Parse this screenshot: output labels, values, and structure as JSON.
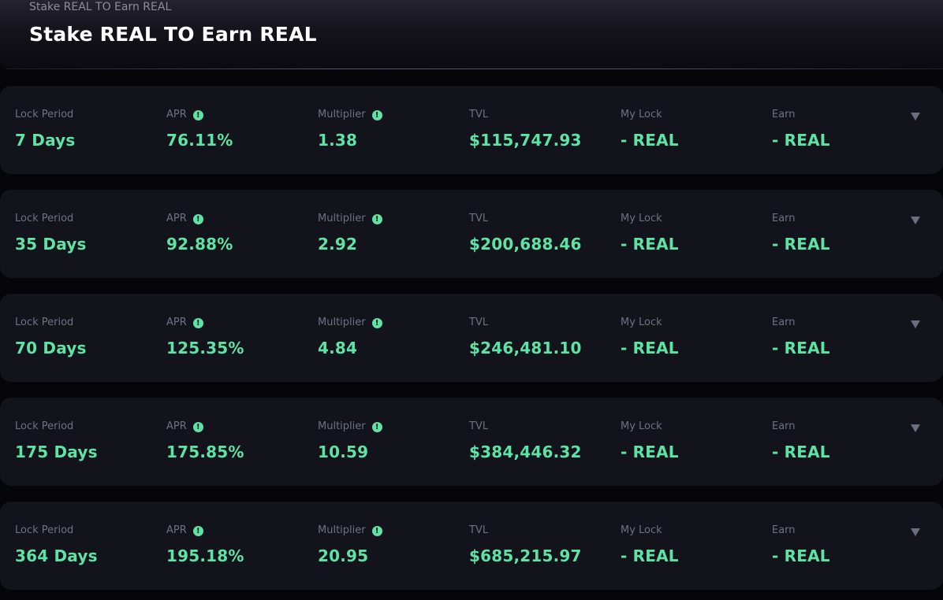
{
  "header": {
    "breadcrumb": "Stake REAL TO Earn REAL",
    "title": "Stake REAL TO Earn REAL"
  },
  "labels": {
    "lock_period": "Lock Period",
    "apr": "APR",
    "multiplier": "Multiplier",
    "tvl": "TVL",
    "my_lock": "My Lock",
    "earn": "Earn"
  },
  "icons": {
    "info": "info-icon",
    "expand": "chevron-down-icon"
  },
  "colors": {
    "accent": "#5fe3a5",
    "background": "#060509",
    "card": "#12131b",
    "label": "#6e7283"
  },
  "pools": [
    {
      "lock_period": "7 Days",
      "apr": "76.11%",
      "multiplier": "1.38",
      "tvl": "$115,747.93",
      "my_lock": "- REAL",
      "earn": "- REAL"
    },
    {
      "lock_period": "35 Days",
      "apr": "92.88%",
      "multiplier": "2.92",
      "tvl": "$200,688.46",
      "my_lock": "- REAL",
      "earn": "- REAL"
    },
    {
      "lock_period": "70 Days",
      "apr": "125.35%",
      "multiplier": "4.84",
      "tvl": "$246,481.10",
      "my_lock": "- REAL",
      "earn": "- REAL"
    },
    {
      "lock_period": "175 Days",
      "apr": "175.85%",
      "multiplier": "10.59",
      "tvl": "$384,446.32",
      "my_lock": "- REAL",
      "earn": "- REAL"
    },
    {
      "lock_period": "364 Days",
      "apr": "195.18%",
      "multiplier": "20.95",
      "tvl": "$685,215.97",
      "my_lock": "- REAL",
      "earn": "- REAL"
    }
  ]
}
